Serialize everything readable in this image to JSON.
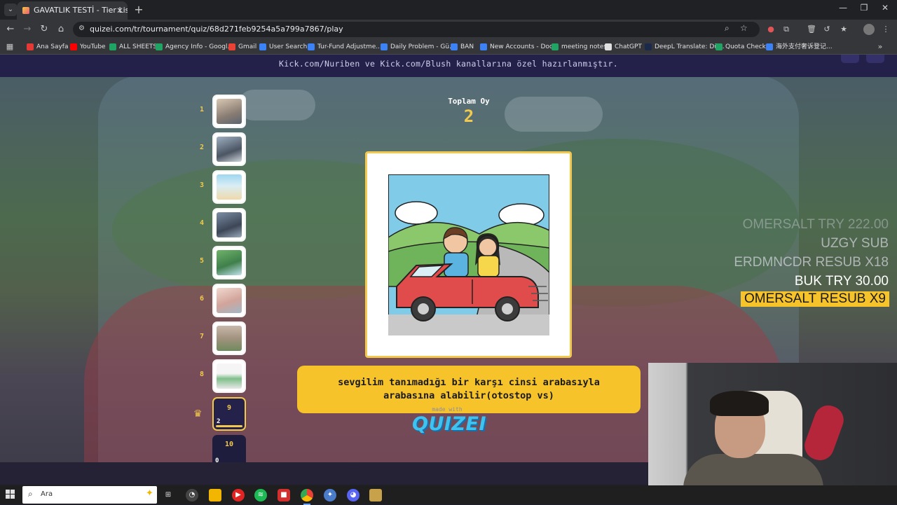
{
  "browser": {
    "tab_title": "GAVATLIK TESTİ - Tier List, Kör S",
    "url": "quizei.com/tr/tournament/quiz/68d271feb9254a5a799a7867/play",
    "bookmarks": [
      "Ana Sayfa",
      "YouTube",
      "ALL SHEETS",
      "Agency Info - Googl...",
      "Gmail",
      "User Search",
      "Tur-Fund Adjustme...",
      "Daily Problem - Gü...",
      "BAN",
      "New Accounts - Docs",
      "meeting notes",
      "ChatGPT",
      "DeepL Translate: Dü...",
      "Quota Check",
      "海外支付奢诉登记..."
    ]
  },
  "page": {
    "header_text": "Kick.com/Nuriben ve Kick.com/Blush kanallarına özel hazırlanmıştır.",
    "total_label": "Toplam Oy",
    "total_value": "2",
    "caption": "sevgilim tanımadığı bir karşı cinsi arabasıyla arabasına alabilir(otostop vs)",
    "made_with": "made with",
    "logo": "QUIZEI",
    "ranks": [
      {
        "num": "1"
      },
      {
        "num": "2"
      },
      {
        "num": "3"
      },
      {
        "num": "4"
      },
      {
        "num": "5"
      },
      {
        "num": "6"
      },
      {
        "num": "7"
      },
      {
        "num": "8"
      }
    ],
    "slots": [
      {
        "num": "9",
        "votes": "2"
      },
      {
        "num": "10",
        "votes": "0"
      }
    ]
  },
  "overlay": [
    "OMERSALT  TRY 222.00",
    "UZGY  SUB",
    "ERDMNCDR  RESUB X18",
    "BUK  TRY 30.00",
    "OMERSALT  RESUB X9"
  ],
  "taskbar": {
    "search_placeholder": "Ara"
  },
  "colors": {
    "accent": "#f2c94c",
    "caption_bg": "#f6c42a",
    "header_bg": "#23204a",
    "logo": "#3ec3f0"
  }
}
